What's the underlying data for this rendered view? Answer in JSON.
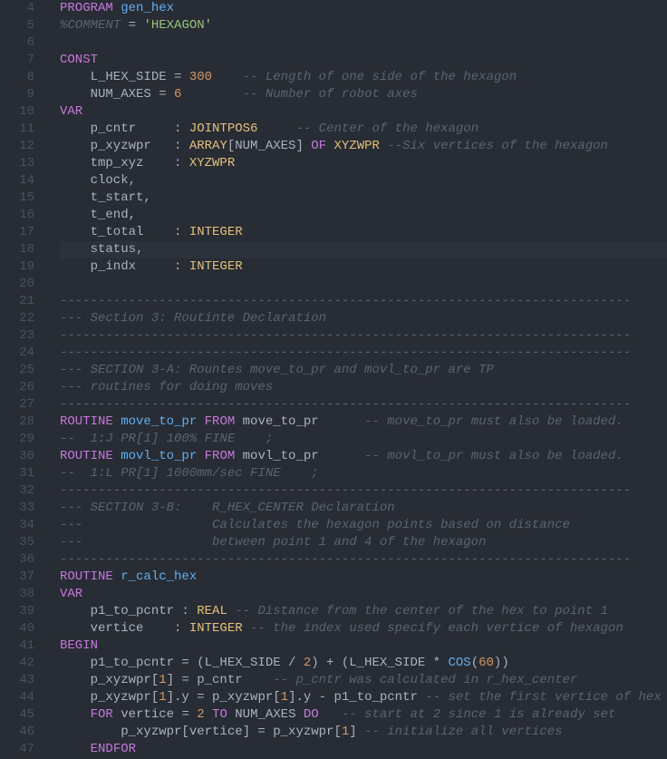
{
  "startLine": 4,
  "highlightLine": 18,
  "lines": [
    [
      {
        "c": "kw",
        "t": "PROGRAM"
      },
      {
        "c": "",
        "t": " "
      },
      {
        "c": "fn",
        "t": "gen_hex"
      }
    ],
    [
      {
        "c": "cm",
        "t": "%COMMENT"
      },
      {
        "c": "",
        "t": " = "
      },
      {
        "c": "st",
        "t": "'HEXAGON'"
      }
    ],
    [],
    [
      {
        "c": "kw",
        "t": "CONST"
      }
    ],
    [
      {
        "c": "",
        "t": "    L_HEX_SIDE = "
      },
      {
        "c": "nu",
        "t": "300"
      },
      {
        "c": "",
        "t": "    "
      },
      {
        "c": "cm",
        "t": "-- Length of one side of the hexagon"
      }
    ],
    [
      {
        "c": "",
        "t": "    NUM_AXES = "
      },
      {
        "c": "nu",
        "t": "6"
      },
      {
        "c": "",
        "t": "        "
      },
      {
        "c": "cm",
        "t": "-- Number of robot axes"
      }
    ],
    [
      {
        "c": "kw",
        "t": "VAR"
      }
    ],
    [
      {
        "c": "",
        "t": "    p_cntr     : "
      },
      {
        "c": "ty",
        "t": "JOINTPOS6"
      },
      {
        "c": "",
        "t": "     "
      },
      {
        "c": "cm",
        "t": "-- Center of the hexagon"
      }
    ],
    [
      {
        "c": "",
        "t": "    p_xyzwpr   : "
      },
      {
        "c": "ty",
        "t": "ARRAY"
      },
      {
        "c": "",
        "t": "[NUM_AXES] "
      },
      {
        "c": "kw",
        "t": "OF"
      },
      {
        "c": "",
        "t": " "
      },
      {
        "c": "ty",
        "t": "XYZWPR"
      },
      {
        "c": "",
        "t": " "
      },
      {
        "c": "cm",
        "t": "--Six vertices of the hexagon"
      }
    ],
    [
      {
        "c": "",
        "t": "    tmp_xyz    : "
      },
      {
        "c": "ty",
        "t": "XYZWPR"
      }
    ],
    [
      {
        "c": "",
        "t": "    clock,"
      }
    ],
    [
      {
        "c": "",
        "t": "    t_start,"
      }
    ],
    [
      {
        "c": "",
        "t": "    t_end,"
      }
    ],
    [
      {
        "c": "",
        "t": "    t_total    : "
      },
      {
        "c": "ty",
        "t": "INTEGER"
      }
    ],
    [
      {
        "c": "",
        "t": "    status,"
      }
    ],
    [
      {
        "c": "",
        "t": "    p_indx     : "
      },
      {
        "c": "ty",
        "t": "INTEGER"
      }
    ],
    [],
    [
      {
        "c": "cm",
        "t": "---------------------------------------------------------------------------"
      }
    ],
    [
      {
        "c": "cm",
        "t": "--- Section 3: Routinte Declaration"
      }
    ],
    [
      {
        "c": "cm",
        "t": "---------------------------------------------------------------------------"
      }
    ],
    [
      {
        "c": "cm",
        "t": "---------------------------------------------------------------------------"
      }
    ],
    [
      {
        "c": "cm",
        "t": "--- SECTION 3-A: Rountes move_to_pr and movl_to_pr are TP"
      }
    ],
    [
      {
        "c": "cm",
        "t": "--- routines for doing moves   "
      }
    ],
    [
      {
        "c": "cm",
        "t": "---------------------------------------------------------------------------"
      }
    ],
    [
      {
        "c": "kw",
        "t": "ROUTINE"
      },
      {
        "c": "",
        "t": " "
      },
      {
        "c": "fn",
        "t": "move_to_pr"
      },
      {
        "c": "",
        "t": " "
      },
      {
        "c": "kw",
        "t": "FROM"
      },
      {
        "c": "",
        "t": " move_to_pr      "
      },
      {
        "c": "cm",
        "t": "-- move_to_pr must also be loaded."
      }
    ],
    [
      {
        "c": "cm",
        "t": "--  1:J PR[1] 100% FINE    ;"
      }
    ],
    [
      {
        "c": "kw",
        "t": "ROUTINE"
      },
      {
        "c": "",
        "t": " "
      },
      {
        "c": "fn",
        "t": "movl_to_pr"
      },
      {
        "c": "",
        "t": " "
      },
      {
        "c": "kw",
        "t": "FROM"
      },
      {
        "c": "",
        "t": " movl_to_pr      "
      },
      {
        "c": "cm",
        "t": "-- movl_to_pr must also be loaded."
      }
    ],
    [
      {
        "c": "cm",
        "t": "--  1:L PR[1] 1000mm/sec FINE    ;"
      }
    ],
    [
      {
        "c": "cm",
        "t": "---------------------------------------------------------------------------"
      }
    ],
    [
      {
        "c": "cm",
        "t": "--- SECTION 3-B:    R_HEX_CENTER Declaration"
      }
    ],
    [
      {
        "c": "cm",
        "t": "---                 Calculates the hexagon points based on distance"
      }
    ],
    [
      {
        "c": "cm",
        "t": "---                 between point 1 and 4 of the hexagon"
      }
    ],
    [
      {
        "c": "cm",
        "t": "---------------------------------------------------------------------------"
      }
    ],
    [
      {
        "c": "kw",
        "t": "ROUTINE"
      },
      {
        "c": "",
        "t": " "
      },
      {
        "c": "fn",
        "t": "r_calc_hex"
      }
    ],
    [
      {
        "c": "kw",
        "t": "VAR"
      }
    ],
    [
      {
        "c": "",
        "t": "    p1_to_pcntr : "
      },
      {
        "c": "ty",
        "t": "REAL"
      },
      {
        "c": "",
        "t": " "
      },
      {
        "c": "cm",
        "t": "-- Distance from the center of the hex to point 1"
      }
    ],
    [
      {
        "c": "",
        "t": "    vertice    : "
      },
      {
        "c": "ty",
        "t": "INTEGER"
      },
      {
        "c": "",
        "t": " "
      },
      {
        "c": "cm",
        "t": "-- the index used specify each vertice of hexagon"
      }
    ],
    [
      {
        "c": "kw",
        "t": "BEGIN"
      }
    ],
    [
      {
        "c": "",
        "t": "    p1_to_pcntr = (L_HEX_SIDE / "
      },
      {
        "c": "nu",
        "t": "2"
      },
      {
        "c": "",
        "t": ") + (L_HEX_SIDE * "
      },
      {
        "c": "fn",
        "t": "COS"
      },
      {
        "c": "",
        "t": "("
      },
      {
        "c": "nu",
        "t": "60"
      },
      {
        "c": "",
        "t": "))"
      }
    ],
    [
      {
        "c": "",
        "t": "    p_xyzwpr["
      },
      {
        "c": "nu",
        "t": "1"
      },
      {
        "c": "",
        "t": "] = p_cntr    "
      },
      {
        "c": "cm",
        "t": "-- p_cntr was calculated in r_hex_center"
      }
    ],
    [
      {
        "c": "",
        "t": "    p_xyzwpr["
      },
      {
        "c": "nu",
        "t": "1"
      },
      {
        "c": "",
        "t": "].y = p_xyzwpr["
      },
      {
        "c": "nu",
        "t": "1"
      },
      {
        "c": "",
        "t": "].y - p1_to_pcntr "
      },
      {
        "c": "cm",
        "t": "-- set the first vertice of hex"
      }
    ],
    [
      {
        "c": "",
        "t": "    "
      },
      {
        "c": "kw",
        "t": "FOR"
      },
      {
        "c": "",
        "t": " vertice = "
      },
      {
        "c": "nu",
        "t": "2"
      },
      {
        "c": "",
        "t": " "
      },
      {
        "c": "kw",
        "t": "TO"
      },
      {
        "c": "",
        "t": " NUM_AXES "
      },
      {
        "c": "kw",
        "t": "DO"
      },
      {
        "c": "",
        "t": "   "
      },
      {
        "c": "cm",
        "t": "-- start at 2 since 1 is already set"
      }
    ],
    [
      {
        "c": "",
        "t": "        p_xyzwpr[vertice] = p_xyzwpr["
      },
      {
        "c": "nu",
        "t": "1"
      },
      {
        "c": "",
        "t": "] "
      },
      {
        "c": "cm",
        "t": "-- initialize all vertices"
      }
    ],
    [
      {
        "c": "",
        "t": "    "
      },
      {
        "c": "kw",
        "t": "ENDFOR"
      }
    ]
  ]
}
